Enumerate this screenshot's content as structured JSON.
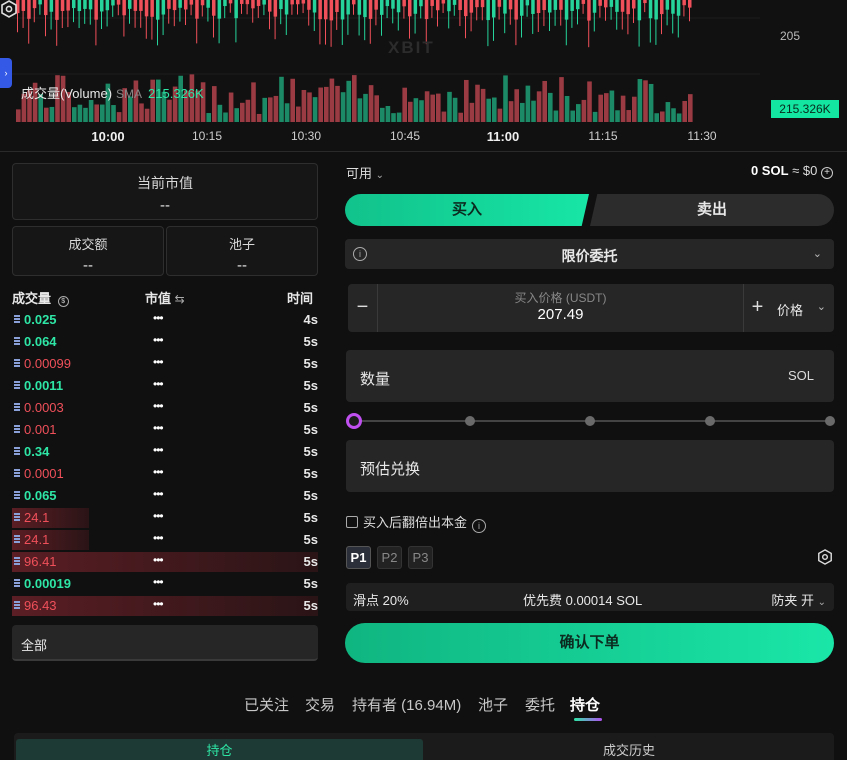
{
  "chart": {
    "price_tick": "205",
    "watermark": "XBIT",
    "volume_title": "成交量(Volume)",
    "sma_label": "SMA",
    "volume_value": "215.326K",
    "volume_badge": "215.326K",
    "time_ticks": [
      {
        "label": "10:00",
        "bold": true
      },
      {
        "label": "10:15",
        "bold": false
      },
      {
        "label": "10:30",
        "bold": false
      },
      {
        "label": "10:45",
        "bold": false
      },
      {
        "label": "11:00",
        "bold": true
      },
      {
        "label": "11:15",
        "bold": false
      },
      {
        "label": "11:30",
        "bold": false
      }
    ],
    "colors": {
      "up": "#26d39a",
      "down": "#f0505a"
    }
  },
  "stats": {
    "market_cap_label": "当前市值",
    "market_cap_value": "--",
    "turnover_label": "成交额",
    "turnover_value": "--",
    "pool_label": "池子",
    "pool_value": "--"
  },
  "trades": {
    "headers": {
      "volume": "成交量",
      "market_cap": "市值",
      "time": "时间"
    },
    "rows": [
      {
        "amount": "0.025",
        "side": "buy",
        "mcap": "•••",
        "time": "4s",
        "bar": 0
      },
      {
        "amount": "0.064",
        "side": "buy",
        "mcap": "•••",
        "time": "5s",
        "bar": 0
      },
      {
        "amount": "0.00099",
        "side": "sell",
        "mcap": "•••",
        "time": "5s",
        "bar": 0
      },
      {
        "amount": "0.0011",
        "side": "buy",
        "mcap": "•••",
        "time": "5s",
        "bar": 0
      },
      {
        "amount": "0.0003",
        "side": "sell",
        "mcap": "•••",
        "time": "5s",
        "bar": 0
      },
      {
        "amount": "0.001",
        "side": "sell",
        "mcap": "•••",
        "time": "5s",
        "bar": 0
      },
      {
        "amount": "0.34",
        "side": "buy",
        "mcap": "•••",
        "time": "5s",
        "bar": 0
      },
      {
        "amount": "0.0001",
        "side": "sell",
        "mcap": "•••",
        "time": "5s",
        "bar": 0
      },
      {
        "amount": "0.065",
        "side": "buy",
        "mcap": "•••",
        "time": "5s",
        "bar": 0
      },
      {
        "amount": "24.1",
        "side": "sell",
        "mcap": "•••",
        "time": "5s",
        "bar": 0.25
      },
      {
        "amount": "24.1",
        "side": "sell",
        "mcap": "•••",
        "time": "5s",
        "bar": 0.25
      },
      {
        "amount": "96.41",
        "side": "sell",
        "mcap": "•••",
        "time": "5s",
        "bar": 1.0
      },
      {
        "amount": "0.00019",
        "side": "buy",
        "mcap": "•••",
        "time": "5s",
        "bar": 0
      },
      {
        "amount": "96.43",
        "side": "sell",
        "mcap": "•••",
        "time": "5s",
        "bar": 1.0
      }
    ],
    "filter_value": "全部"
  },
  "order": {
    "available_label": "可用",
    "balance": "0 SOL",
    "balance_approx": "≈ $0",
    "buy_tab": "买入",
    "sell_tab": "卖出",
    "order_type": "限价委托",
    "price_caption": "买入价格 (USDT)",
    "price_value": "207.49",
    "price_unit": "价格",
    "qty_label": "数量",
    "qty_unit": "SOL",
    "slider_fraction": 0,
    "estimate_label": "预估兑换",
    "double_label": "买入后翻倍出本金",
    "presets": [
      "P1",
      "P2",
      "P3"
    ],
    "slippage": "滑点 20%",
    "priority_fee": "优先费 0.00014 SOL",
    "mev": "防夹 开",
    "confirm": "确认下单"
  },
  "bottom": {
    "tabs": [
      "已关注",
      "交易",
      "持有者 (16.94M)",
      "池子",
      "委托",
      "持仓"
    ],
    "active_tab": 5,
    "segments": [
      "持仓",
      "成交历史"
    ]
  }
}
